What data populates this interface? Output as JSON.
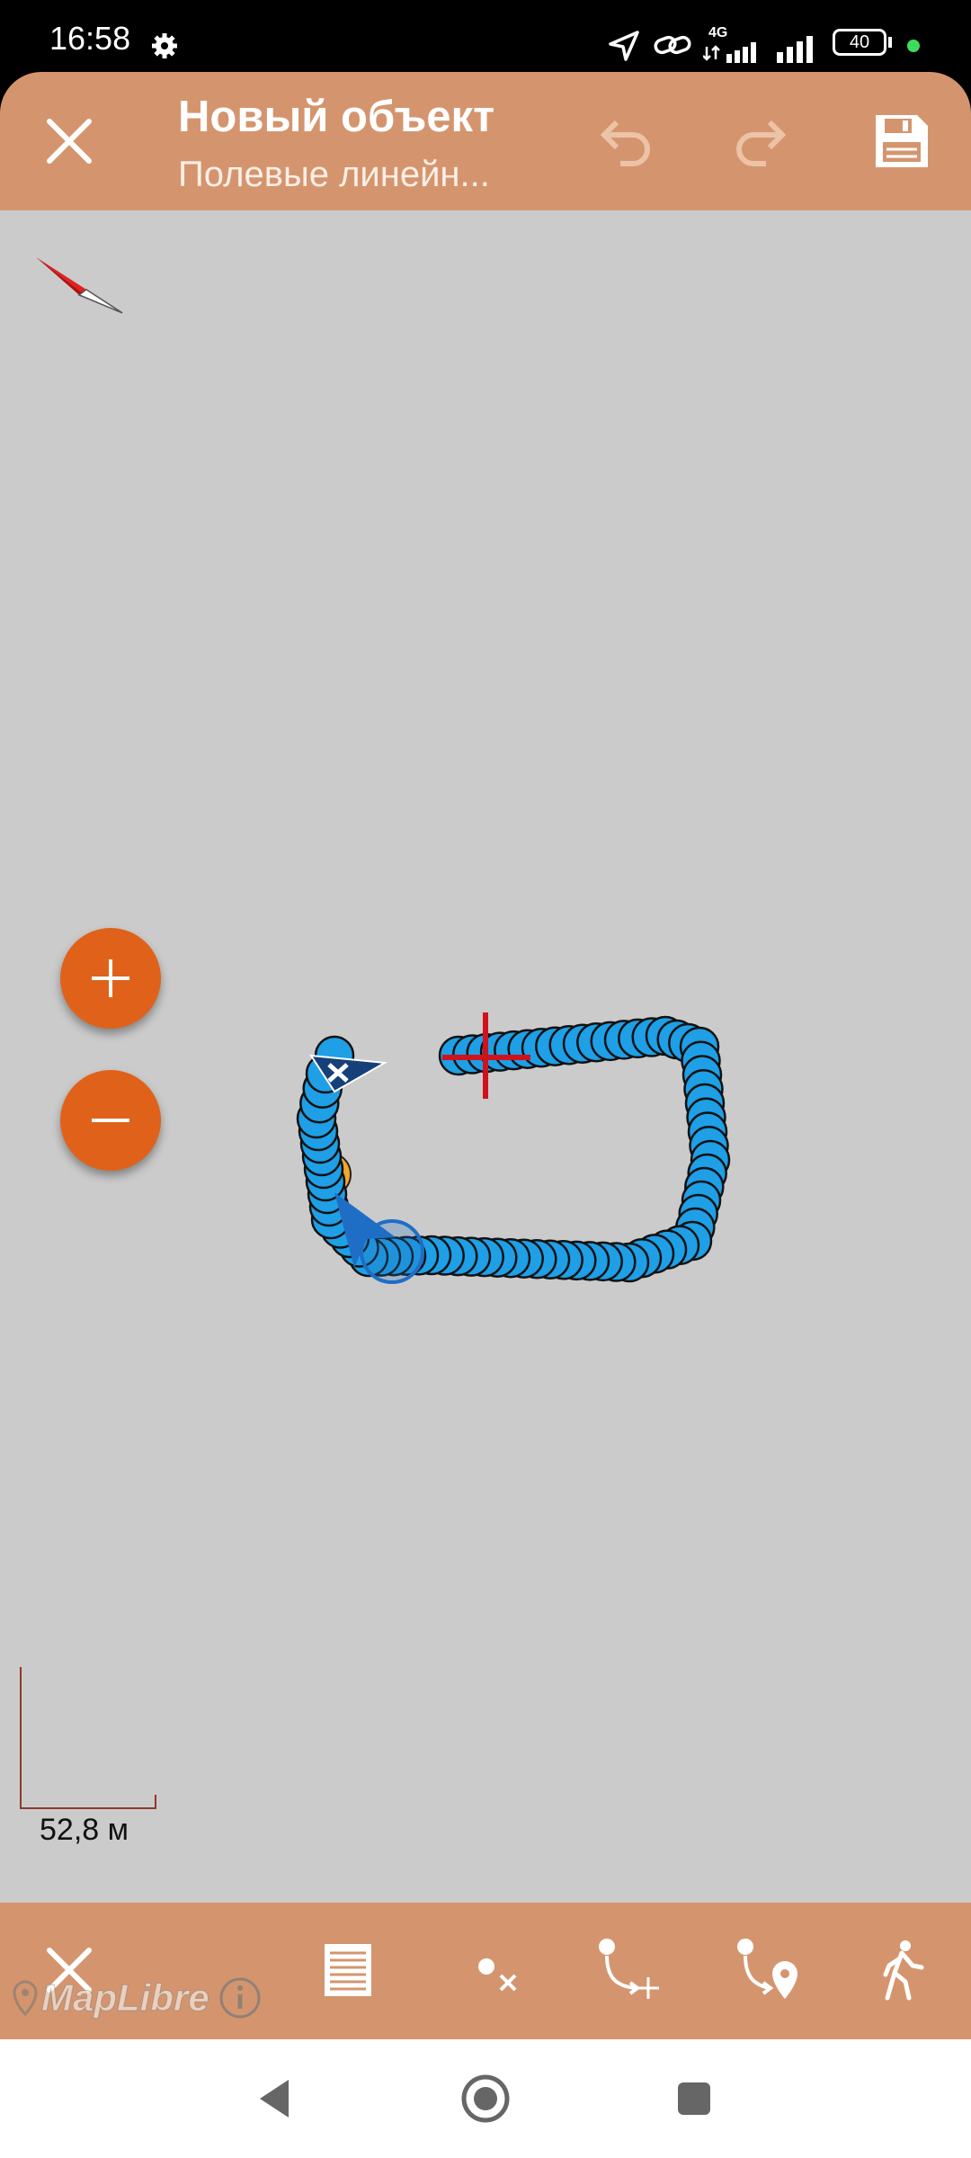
{
  "status_bar": {
    "time": "16:58",
    "network": "4G",
    "battery": "40",
    "icons": [
      "gear-icon",
      "location-arrow-icon",
      "link-icon",
      "signal-icon",
      "signal-icon",
      "battery-icon"
    ]
  },
  "toolbar": {
    "title": "Новый объект",
    "subtitle": "Полевые линейн...",
    "icons": {
      "close": "close-icon",
      "undo": "undo-icon",
      "redo": "redo-icon",
      "save": "save-icon"
    }
  },
  "map": {
    "background": "#cbcbcb",
    "track_color": "#1e9fe6",
    "scale_label": "52,8 м",
    "attribution": "MapLibre"
  },
  "bottom_bar": {
    "icons": [
      "close-icon",
      "list-icon",
      "delete-vertex-icon",
      "add-vertex-icon",
      "add-point-icon",
      "walk-icon"
    ]
  },
  "colors": {
    "accent": "#d4956e",
    "zoom_button": "#e0621a",
    "track": "#1e9fe6",
    "crosshair": "#d0121c"
  }
}
